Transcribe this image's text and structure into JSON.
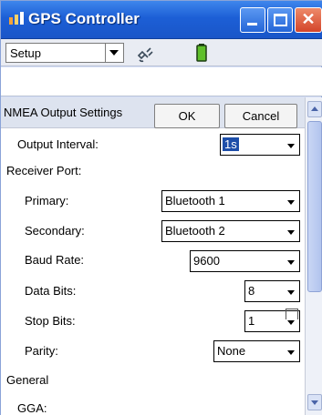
{
  "window": {
    "title": "GPS Controller"
  },
  "toolbar": {
    "menu_value": "Setup"
  },
  "panel": {
    "title": "NMEA Output Settings",
    "ok_label": "OK",
    "cancel_label": "Cancel"
  },
  "fields": {
    "output_interval": {
      "label": "Output Interval:",
      "value": "1s"
    },
    "receiver_port_label": "Receiver Port:",
    "primary": {
      "label": "Primary:",
      "value": "Bluetooth 1"
    },
    "secondary": {
      "label": "Secondary:",
      "value": "Bluetooth 2"
    },
    "baud_rate": {
      "label": "Baud Rate:",
      "value": "9600"
    },
    "data_bits": {
      "label": "Data Bits:",
      "value": "8"
    },
    "stop_bits": {
      "label": "Stop Bits:",
      "value": "1"
    },
    "parity": {
      "label": "Parity:",
      "value": "None"
    },
    "general_label": "General",
    "gga": {
      "label": "GGA:"
    }
  },
  "icons": [
    "gps-app-icon",
    "satellite-icon",
    "battery-icon",
    "minimize-icon",
    "maximize-icon",
    "close-icon"
  ],
  "colors": {
    "titlebar": "#1c5fd6",
    "selection": "#1d4ea9",
    "close_button": "#d4452a"
  }
}
